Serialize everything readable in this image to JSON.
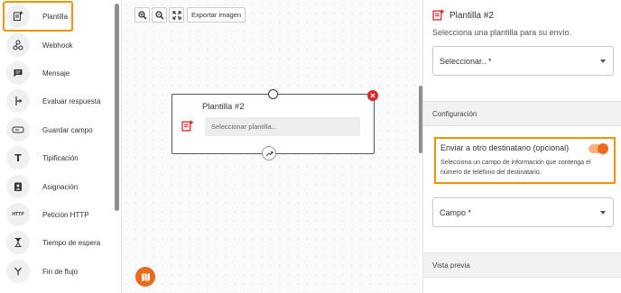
{
  "sidebar": {
    "items": [
      {
        "label": "Plantilla",
        "icon": "template-icon"
      },
      {
        "label": "Webhook",
        "icon": "webhook-icon"
      },
      {
        "label": "Mensaje",
        "icon": "message-icon"
      },
      {
        "label": "Evaluar respuesta",
        "icon": "branch-icon"
      },
      {
        "label": "Guardar campo",
        "icon": "field-icon"
      },
      {
        "label": "Tipificación",
        "icon": "typification-icon"
      },
      {
        "label": "Asignación",
        "icon": "assignment-icon"
      },
      {
        "label": "Petición HTTP",
        "icon": "http-icon"
      },
      {
        "label": "Tiempo de espera",
        "icon": "hourglass-icon"
      },
      {
        "label": "Fin de flujo",
        "icon": "end-flow-icon"
      }
    ],
    "http_glyph": "HTTP",
    "t_glyph": "T"
  },
  "canvas": {
    "export_label": "Exportar imagen",
    "node": {
      "title": "Plantilla #2",
      "field_placeholder": "Seleccionar plantilla..."
    }
  },
  "panel": {
    "title": "Plantilla #2",
    "subtitle": "Selecciona una plantilla para su envío.",
    "template_select": "Seleccionar.. *",
    "config_section": "Configuración",
    "other_recipient": {
      "label": "Enviar a otro destinatario (opcional)",
      "description": "Selecciona un campo de información que contenga el número de teléfono del destinatario.",
      "enabled": true
    },
    "field_select": "Campo *",
    "preview_section": "Vista previa"
  },
  "colors": {
    "accent": "#ec6a1c",
    "highlight": "#f39200",
    "danger": "#e02424"
  }
}
